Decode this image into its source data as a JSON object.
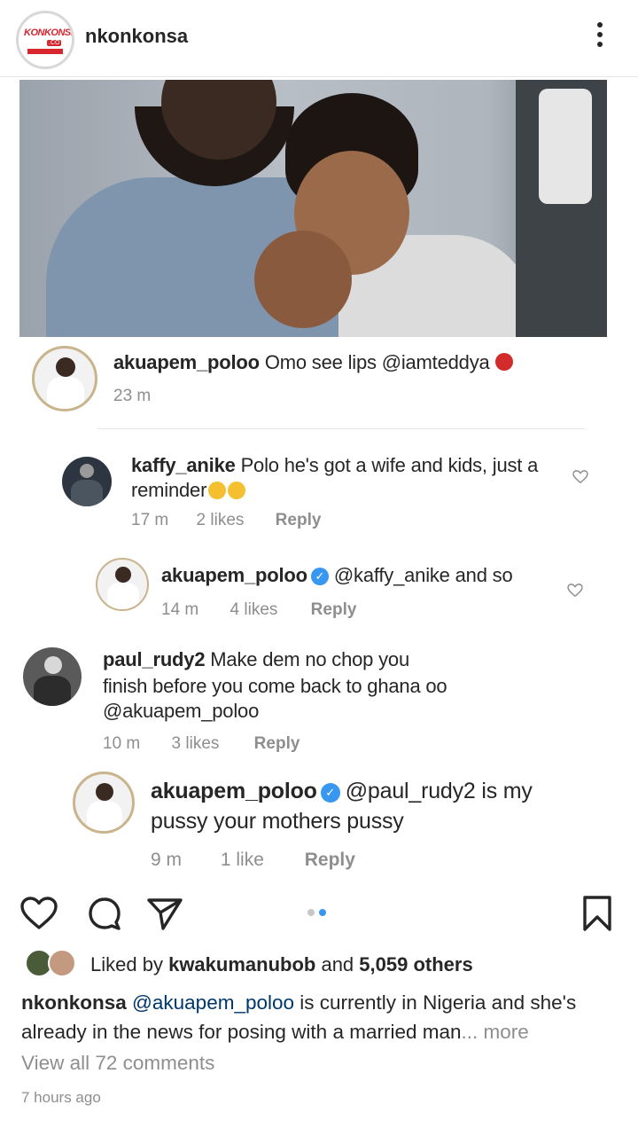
{
  "header": {
    "username": "nkonkonsa",
    "logo_text": "KONKONSA",
    "logo_suffix": ".CO"
  },
  "screenshot_comments": [
    {
      "username": "akuapem_poloo",
      "text": "Omo see lips @iamteddya",
      "emoji": "tongue",
      "time": "23 m"
    },
    {
      "username": "kaffy_anike",
      "text_line1": "Polo he's got a wife and kids, just a",
      "text_line2": "reminder",
      "emoji": "laughing-tears",
      "time": "17 m",
      "likes": "2 likes",
      "reply": "Reply"
    },
    {
      "username": "akuapem_poloo",
      "verified": true,
      "text": "@kaffy_anike and so",
      "time": "14 m",
      "likes": "4 likes",
      "reply": "Reply"
    },
    {
      "username": "paul_rudy2",
      "text_line1": "Make dem no chop you",
      "text_line2": "finish before you come back to ghana oo",
      "text_line3": "@akuapem_poloo",
      "time": "10 m",
      "likes": "3 likes",
      "reply": "Reply"
    },
    {
      "username": "akuapem_poloo",
      "verified": true,
      "text_line1": "@paul_rudy2 is my",
      "text_line2": "pussy your mothers pussy",
      "time": "9 m",
      "likes": "1 like",
      "reply": "Reply"
    }
  ],
  "carousel": {
    "count": 2,
    "active_index": 1
  },
  "likes": {
    "prefix": "Liked by",
    "user": "kwakumanubob",
    "and_text": "and",
    "others": "5,059 others"
  },
  "caption": {
    "username": "nkonkonsa",
    "mention": "@akuapem_poloo",
    "text": "is currently in Nigeria and she's already in the news for posing with a married man",
    "more": "... more"
  },
  "view_all": "View all 72 comments",
  "time_ago": "7 hours ago",
  "colors": {
    "text": "#262626",
    "secondary": "#8e8e8e",
    "accent_blue": "#3897f0",
    "brand_red": "#d7262e"
  }
}
